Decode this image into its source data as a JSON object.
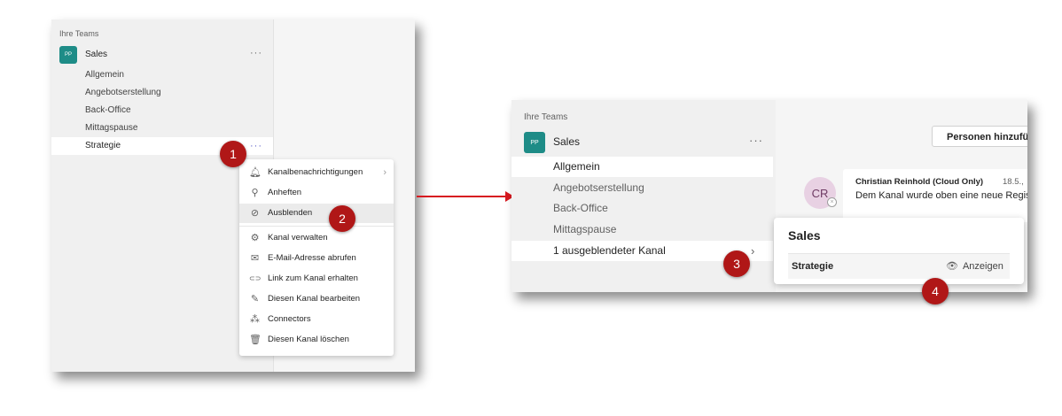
{
  "left": {
    "heading": "Ihre Teams",
    "team": {
      "avatar": "PP",
      "name": "Sales",
      "more": "···"
    },
    "channels": [
      {
        "label": "Allgemein"
      },
      {
        "label": "Angebotserstellung"
      },
      {
        "label": "Back-Office"
      },
      {
        "label": "Mittagspause"
      },
      {
        "label": "Strategie",
        "more": "···"
      }
    ],
    "context_menu": [
      {
        "label": "Kanalbenachrichtigungen",
        "icon": "bell-icon",
        "glyph": "🔔︎",
        "chevron": "›"
      },
      {
        "label": "Anheften",
        "icon": "pin-icon",
        "glyph": "⚲"
      },
      {
        "label": "Ausblenden",
        "icon": "eye-off-icon",
        "glyph": "⊘"
      },
      {
        "label": "Kanal verwalten",
        "icon": "gear-icon",
        "glyph": "⚙"
      },
      {
        "label": "E-Mail-Adresse abrufen",
        "icon": "mail-icon",
        "glyph": "✉"
      },
      {
        "label": "Link zum Kanal erhalten",
        "icon": "link-icon",
        "glyph": "⊂⊃"
      },
      {
        "label": "Diesen Kanal bearbeiten",
        "icon": "pencil-icon",
        "glyph": "✎"
      },
      {
        "label": "Connectors",
        "icon": "connectors-icon",
        "glyph": "⁂"
      },
      {
        "label": "Diesen Kanal löschen",
        "icon": "trash-icon",
        "glyph": "🗑︎"
      }
    ]
  },
  "markers": [
    "1",
    "2",
    "3",
    "4"
  ],
  "right": {
    "heading": "Ihre Teams",
    "team": {
      "avatar": "PP",
      "name": "Sales",
      "more": "···"
    },
    "channels": [
      {
        "label": "Allgemein"
      },
      {
        "label": "Angebotserstellung"
      },
      {
        "label": "Back-Office"
      },
      {
        "label": "Mittagspause"
      },
      {
        "label": "1 ausgeblendeter Kanal",
        "chevron": "›"
      }
    ],
    "add_people_button": "Personen hinzufügen",
    "message": {
      "avatar": "CR",
      "author": "Christian Reinhold (Cloud Only)",
      "time": "18.5.,",
      "text": "Dem Kanal wurde oben eine neue Registerkarte hinzugefügt."
    },
    "hidden_popup": {
      "title": "Sales",
      "channel": "Strategie",
      "show_label": "Anzeigen"
    }
  },
  "colors": {
    "marker": "#b01717",
    "arrow": "#d71920",
    "team_avatar": "#1e8c87",
    "accent": "#5b5fc7"
  }
}
